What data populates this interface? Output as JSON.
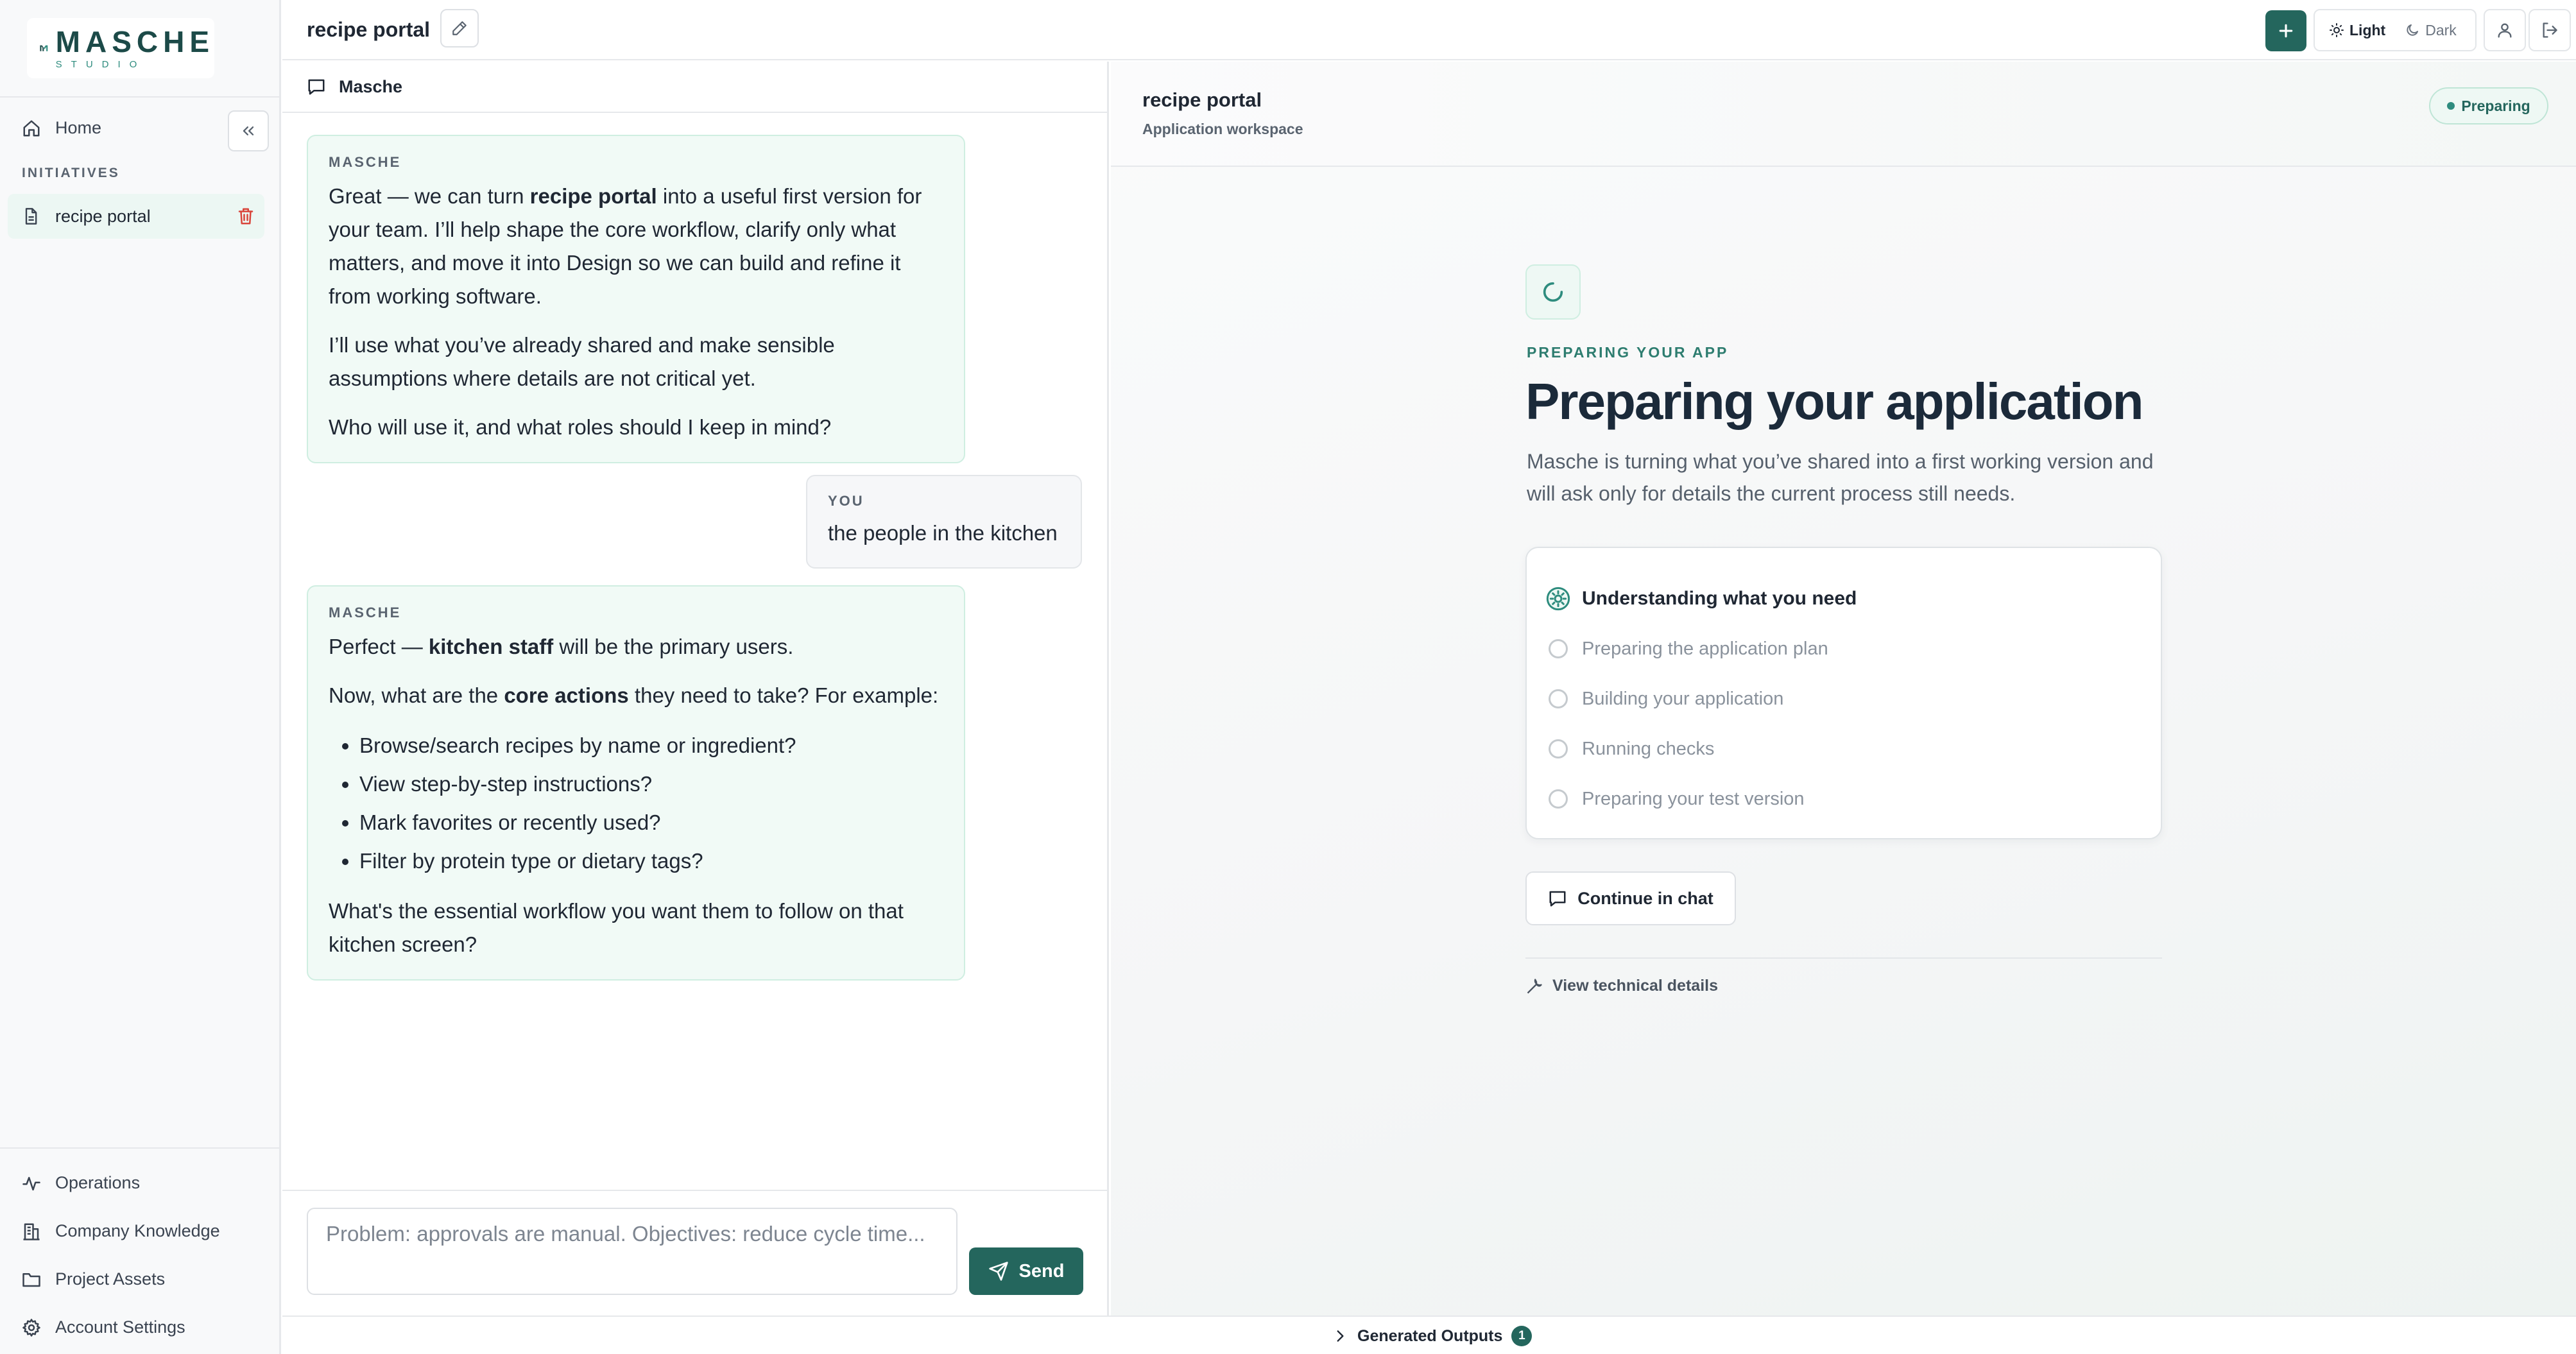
{
  "brand": {
    "name": "MASCHE",
    "sub": "STUDIO"
  },
  "sidebar": {
    "home": "Home",
    "section": "INITIATIVES",
    "initiatives": [
      {
        "label": "recipe portal"
      }
    ],
    "bottom": [
      {
        "label": "Operations",
        "icon": "activity-icon"
      },
      {
        "label": "Company Knowledge",
        "icon": "building-icon"
      },
      {
        "label": "Project Assets",
        "icon": "folder-icon"
      },
      {
        "label": "Account Settings",
        "icon": "gear-icon"
      }
    ]
  },
  "topbar": {
    "title": "recipe portal",
    "theme_light": "Light",
    "theme_dark": "Dark"
  },
  "chat": {
    "header": "Masche",
    "messages": [
      {
        "who": "MASCHE",
        "p1_a": "Great — we can turn ",
        "p1_b": "recipe portal",
        "p1_c": " into a useful first version for your team. I’ll help shape the core workflow, clarify only what matters, and move it into Design so we can build and refine it from working software.",
        "p2": "I’ll use what you’ve already shared and make sensible assumptions where details are not critical yet.",
        "p3": "Who will use it, and what roles should I keep in mind?"
      },
      {
        "who": "YOU",
        "text": "the people in the kitchen"
      },
      {
        "who": "MASCHE",
        "p1_a": "Perfect — ",
        "p1_b": "kitchen staff",
        "p1_c": " will be the primary users.",
        "p2_a": "Now, what are the ",
        "p2_b": "core actions",
        "p2_c": " they need to take? For example:",
        "bullets": [
          "Browse/search recipes by name or ingredient?",
          "View step-by-step instructions?",
          "Mark favorites or recently used?",
          "Filter by protein type or dietary tags?"
        ],
        "p3": "What's the essential workflow you want them to follow on that kitchen screen?"
      }
    ],
    "composer_placeholder": "Problem: approvals are manual. Objectives: reduce cycle time...",
    "send_label": "Send"
  },
  "workspace": {
    "title": "recipe portal",
    "subtitle": "Application workspace",
    "status": "Preparing",
    "eyebrow": "PREPARING YOUR APP",
    "heading": "Preparing your application",
    "description": "Masche is turning what you’ve shared into a first working version and will ask only for details the current process still needs.",
    "steps": [
      {
        "label": "Understanding what you need",
        "state": "active"
      },
      {
        "label": "Preparing the application plan",
        "state": "pending"
      },
      {
        "label": "Building your application",
        "state": "pending"
      },
      {
        "label": "Running checks",
        "state": "pending"
      },
      {
        "label": "Preparing your test version",
        "state": "pending"
      }
    ],
    "continue_label": "Continue in chat",
    "tech_label": "View technical details"
  },
  "outputs": {
    "label": "Generated Outputs",
    "count": "1"
  },
  "colors": {
    "accent": "#24665d",
    "accent_light": "#eef8f4",
    "bubble_ai": "#f1faf6"
  }
}
